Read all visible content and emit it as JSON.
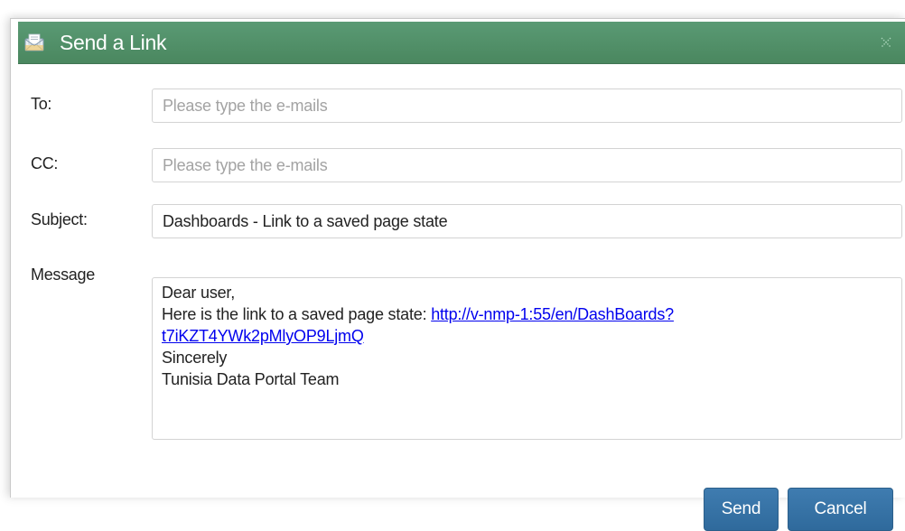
{
  "dialog": {
    "title": "Send a Link",
    "icons": {
      "title_icon": "envelope-icon",
      "close_icon": "close-icon"
    },
    "colors": {
      "titlebar": "#4f8e68",
      "button": "#3574a8",
      "link": "#0000ee"
    }
  },
  "form": {
    "to": {
      "label": "To:",
      "value": "",
      "placeholder": "Please type the e-mails"
    },
    "cc": {
      "label": "CC:",
      "value": "",
      "placeholder": "Please type the e-mails"
    },
    "subject": {
      "label": "Subject:",
      "value": "Dashboards - Link to a saved page state"
    },
    "message": {
      "label": "Message",
      "greeting": "Dear user,",
      "intro": "Here is the link to a saved page state: ",
      "link_line1": "http://v-nmp-1:55/en/DashBoards?",
      "link_line2": "t7iKZT4YWk2pMlyOP9LjmQ",
      "closing": "Sincerely",
      "signature": "Tunisia Data Portal Team"
    }
  },
  "buttons": {
    "send": "Send",
    "cancel": "Cancel"
  }
}
